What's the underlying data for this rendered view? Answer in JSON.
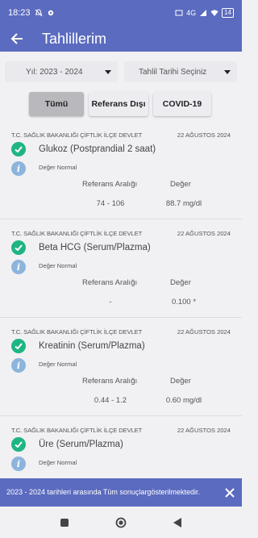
{
  "status_bar": {
    "time": "18:23",
    "network": "4G",
    "battery": "14"
  },
  "header": {
    "title": "Tahlillerim"
  },
  "filters": {
    "year": "Yıl: 2023 - 2024",
    "date": "Tahlil Tarihi Seçiniz"
  },
  "tabs": [
    {
      "label": "Tümü"
    },
    {
      "label": "Referans Dışı"
    },
    {
      "label": "COVID-19"
    }
  ],
  "columns": {
    "reference": "Referans Aralığı",
    "value": "Değer"
  },
  "results": [
    {
      "hospital": "T.C. SAĞLIK BAKANLIĞI ÇİFTLİK İLÇE DEVLET",
      "date": "22 AĞUSTOS 2024",
      "name": "Glukoz (Postprandial 2 saat)",
      "status": "Değer Normal",
      "reference": "74 - 106",
      "value": "88.7 mg/dl"
    },
    {
      "hospital": "T.C. SAĞLIK BAKANLIĞI ÇİFTLİK İLÇE DEVLET",
      "date": "22 AĞUSTOS 2024",
      "name": "Beta HCG (Serum/Plazma)",
      "status": "Değer Normal",
      "reference": "-",
      "value": "0.100 *"
    },
    {
      "hospital": "T.C. SAĞLIK BAKANLIĞI ÇİFTLİK İLÇE DEVLET",
      "date": "22 AĞUSTOS 2024",
      "name": "Kreatinin (Serum/Plazma)",
      "status": "Değer Normal",
      "reference": "0.44 - 1.2",
      "value": "0.60 mg/dl"
    },
    {
      "hospital": "T.C. SAĞLIK BAKANLIĞI ÇİFTLİK İLÇE DEVLET",
      "date": "22 AĞUSTOS 2024",
      "name": "Üre (Serum/Plazma)",
      "status": "Değer Normal",
      "reference": "",
      "value": ""
    }
  ],
  "snackbar": {
    "message": "2023 - 2024 tarihleri arasında Tüm sonuçlargösterilmektedir."
  },
  "colors": {
    "primary": "#5b6bbf",
    "check": "#1fb582",
    "info": "#8db4dc"
  }
}
